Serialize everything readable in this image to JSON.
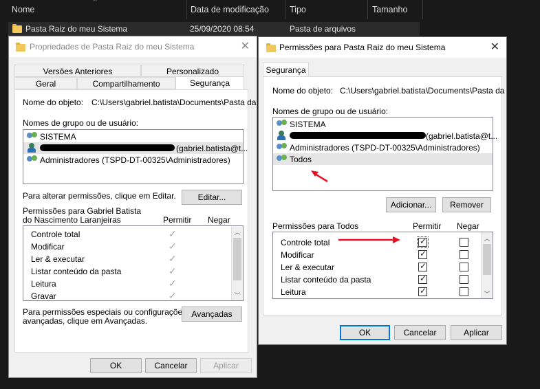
{
  "explorer": {
    "columns": [
      "Nome",
      "Data de modificação",
      "Tipo",
      "Tamanho"
    ],
    "row": {
      "name": "Pasta Raiz do meu Sistema",
      "date": "25/09/2020 08:54",
      "type": "Pasta de arquivos"
    }
  },
  "props": {
    "title": "Propriedades de Pasta Raiz do meu Sistema",
    "tabs_top": [
      "Versões Anteriores",
      "Personalizado"
    ],
    "tabs_bottom": [
      "Geral",
      "Compartilhamento",
      "Segurança"
    ],
    "object_label": "Nome do objeto:",
    "object_value": "C:\\Users\\gabriel.batista\\Documents\\Pasta da",
    "group_label": "Nomes de grupo ou de usuário:",
    "users": [
      "SISTEMA",
      "(gabriel.batista@t...",
      "Administradores (TSPD-DT-00325\\Administradores)"
    ],
    "change_text": "Para alterar permissões, clique em Editar.",
    "edit_button": "Editar...",
    "perm_label_1": "Permissões para Gabriel Batista",
    "perm_label_2": "do Nascimento Laranjeiras",
    "allow_header": "Permitir",
    "deny_header": "Negar",
    "perms": [
      "Controle total",
      "Modificar",
      "Ler & executar",
      "Listar conteúdo da pasta",
      "Leitura",
      "Gravar"
    ],
    "special_text_1": "Para permissões especiais ou configurações",
    "special_text_2": "avançadas, clique em Avançadas.",
    "advanced_button": "Avançadas",
    "ok": "OK",
    "cancel": "Cancelar",
    "apply": "Aplicar"
  },
  "perm_dlg": {
    "title": "Permissões para Pasta Raiz do meu Sistema",
    "tab": "Segurança",
    "object_label": "Nome do objeto:",
    "object_value": "C:\\Users\\gabriel.batista\\Documents\\Pasta da",
    "group_label": "Nomes de grupo ou de usuário:",
    "users": [
      "SISTEMA",
      "(gabriel.batista@t...",
      "Administradores (TSPD-DT-00325\\Administradores)",
      "Todos"
    ],
    "add_button": "Adicionar...",
    "remove_button": "Remover",
    "perm_label": "Permissões para Todos",
    "allow_header": "Permitir",
    "deny_header": "Negar",
    "perms": [
      "Controle total",
      "Modificar",
      "Ler & executar",
      "Listar conteúdo da pasta",
      "Leitura"
    ],
    "allow_checked": [
      true,
      true,
      true,
      true,
      true
    ],
    "deny_checked": [
      false,
      false,
      false,
      false,
      false
    ],
    "ok": "OK",
    "cancel": "Cancelar",
    "apply": "Aplicar"
  },
  "colors": {
    "accent": "#0078d7",
    "arrow": "#e81123",
    "folder": "#f2c85b"
  }
}
